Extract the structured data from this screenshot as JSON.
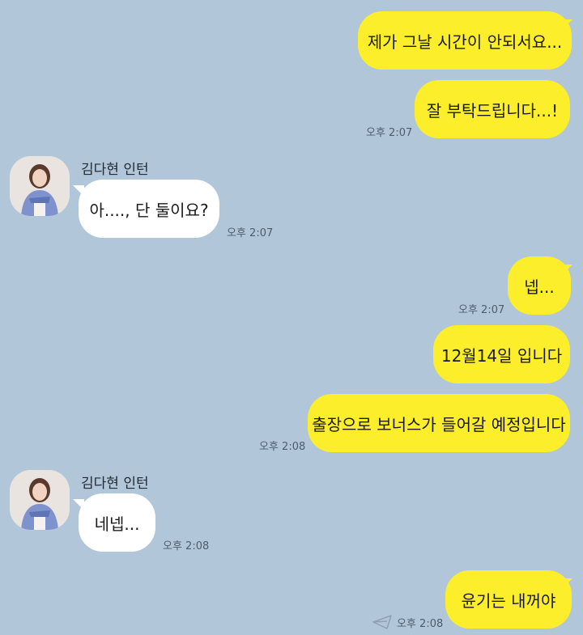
{
  "messages": [
    {
      "text": "제가 그날 시간이 안되서요..."
    },
    {
      "text": "잘 부탁드립니다...!",
      "time": "오후 2:07"
    },
    {
      "sender": "김다현 인턴",
      "text": "아...., 단 둘이요?",
      "time": "오후 2:07"
    },
    {
      "text": "넵...",
      "time": "오후 2:07"
    },
    {
      "text": "12월14일 입니다"
    },
    {
      "text": "출장으로 보너스가 들어갈 예정입니다",
      "time": "오후 2:08"
    },
    {
      "sender": "김다현 인턴",
      "text": "네넵...",
      "time": "오후 2:08"
    },
    {
      "text": "윤기는 내꺼야",
      "time": "오후 2:08",
      "status_icon": "paper-plane-icon"
    }
  ],
  "colors": {
    "background": "#b1c6d8",
    "outgoing_bubble": "#fcee2a",
    "incoming_bubble": "#ffffff"
  }
}
